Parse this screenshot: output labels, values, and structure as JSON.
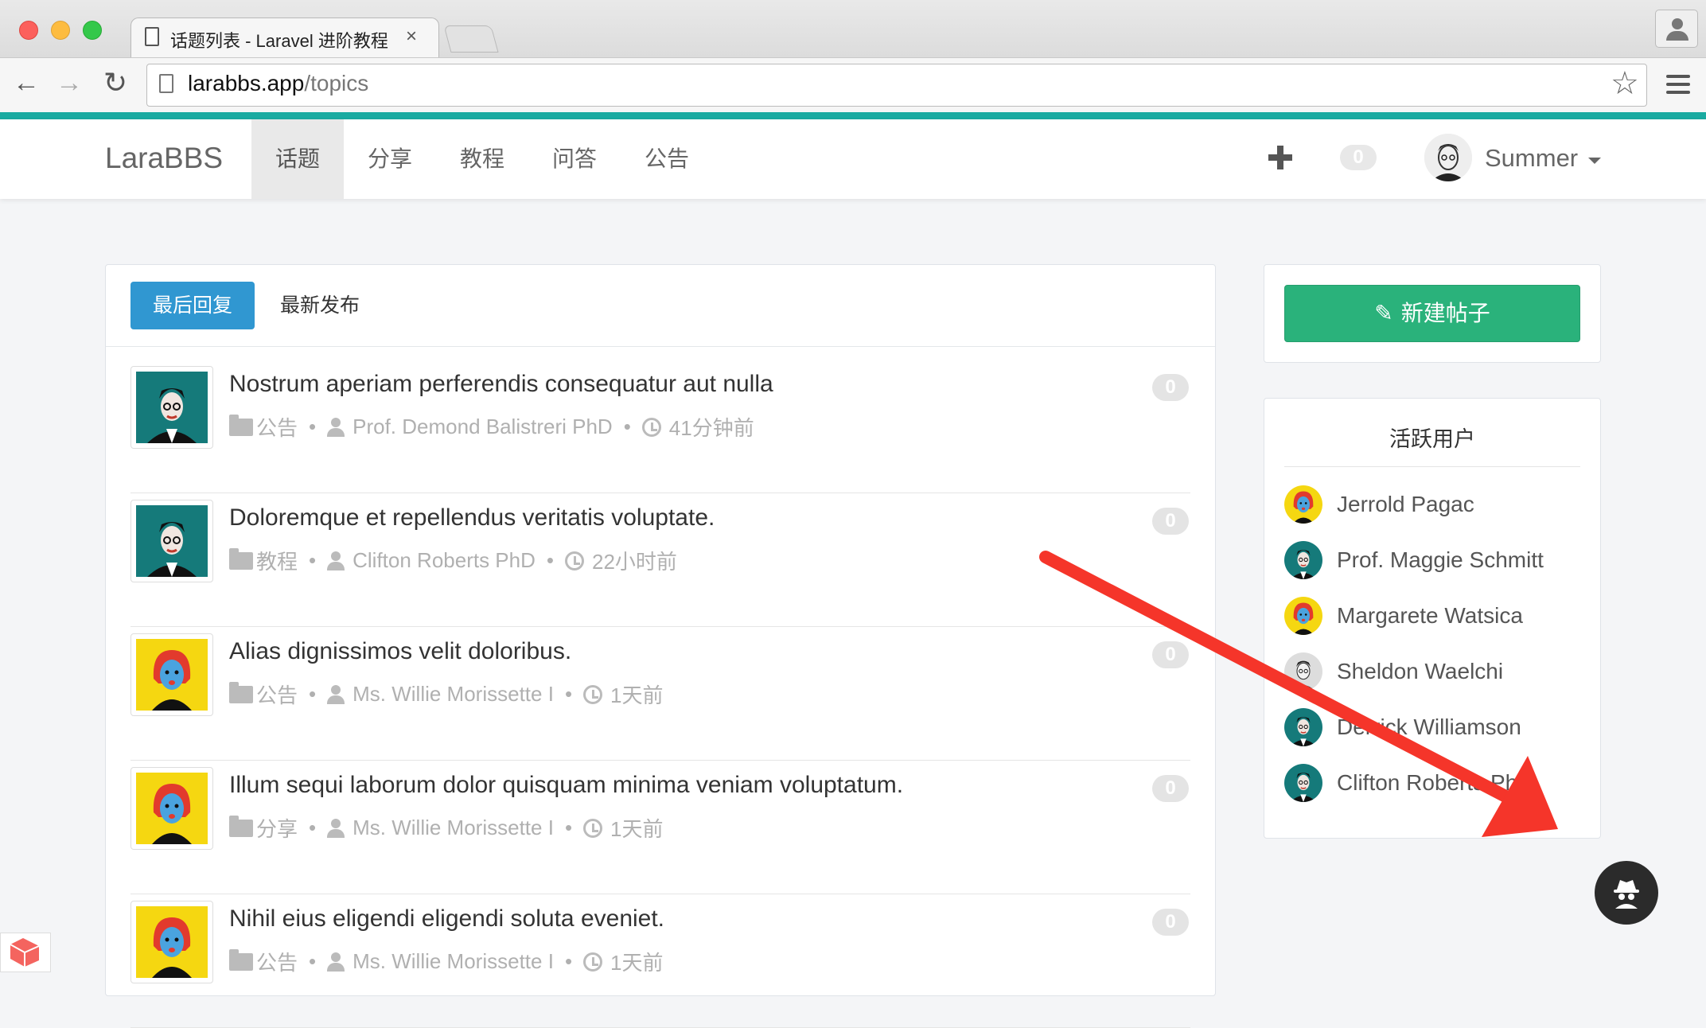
{
  "browser": {
    "tab_title": "话题列表 - Laravel 进阶教程",
    "tab_close": "×",
    "url_host": "larabbs.app",
    "url_path": "/topics",
    "star_icon": "☆"
  },
  "navbar": {
    "brand": "LaraBBS",
    "items": [
      {
        "label": "话题",
        "active": true
      },
      {
        "label": "分享",
        "active": false
      },
      {
        "label": "教程",
        "active": false
      },
      {
        "label": "问答",
        "active": false
      },
      {
        "label": "公告",
        "active": false
      }
    ],
    "notification_count": "0",
    "user_name": "Summer"
  },
  "tabs": {
    "recent_reply": "最后回复",
    "recent_post": "最新发布"
  },
  "topics": [
    {
      "title": "Nostrum aperiam perferendis consequatur aut nulla",
      "category": "公告",
      "author": "Prof. Demond Balistreri PhD",
      "time": "41分钟前",
      "replies": "0",
      "avatar": "man-teal"
    },
    {
      "title": "Doloremque et repellendus veritatis voluptate.",
      "category": "教程",
      "author": "Clifton Roberts PhD",
      "time": "22小时前",
      "replies": "0",
      "avatar": "man-teal"
    },
    {
      "title": "Alias dignissimos velit doloribus.",
      "category": "公告",
      "author": "Ms. Willie Morissette I",
      "time": "1天前",
      "replies": "0",
      "avatar": "woman-yellow"
    },
    {
      "title": "Illum sequi laborum dolor quisquam minima veniam voluptatum.",
      "category": "分享",
      "author": "Ms. Willie Morissette I",
      "time": "1天前",
      "replies": "0",
      "avatar": "woman-yellow"
    },
    {
      "title": "Nihil eius eligendi eligendi soluta eveniet.",
      "category": "公告",
      "author": "Ms. Willie Morissette I",
      "time": "1天前",
      "replies": "0",
      "avatar": "woman-yellow"
    }
  ],
  "sidebar": {
    "new_post_label": "新建帖子",
    "active_users_title": "活跃用户",
    "active_users": [
      {
        "name": "Jerrold Pagac",
        "avatar": "woman-yellow"
      },
      {
        "name": "Prof. Maggie Schmitt",
        "avatar": "man-teal"
      },
      {
        "name": "Margarete Watsica",
        "avatar": "woman-yellow"
      },
      {
        "name": "Sheldon Waelchi",
        "avatar": "man-gray"
      },
      {
        "name": "Derrick Williamson",
        "avatar": "man-teal"
      },
      {
        "name": "Clifton Roberts PhD",
        "avatar": "man-teal"
      }
    ]
  },
  "colors": {
    "accent_teal": "#1aaba1",
    "primary_blue": "#3097d1",
    "success_green": "#2ab27b",
    "annotation_arrow": "#f5352a"
  }
}
